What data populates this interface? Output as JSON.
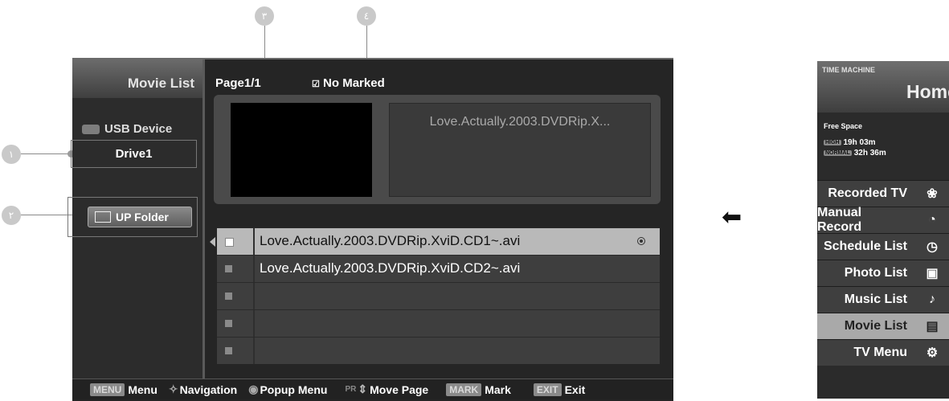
{
  "callouts": [
    "١",
    "٢",
    "٣",
    "٤"
  ],
  "screen": {
    "title": "Movie List",
    "device": "USB Device",
    "drive": "Drive1",
    "up_folder": "UP Folder",
    "page": "Page1/1",
    "marked": "No Marked",
    "preview_title": "Love.Actually.2003.DVDRip.X...",
    "files": [
      {
        "name": "Love.Actually.2003.DVDRip.XviD.CD1~.avi",
        "selected": true
      },
      {
        "name": "Love.Actually.2003.DVDRip.XviD.CD2~.avi",
        "selected": false
      },
      {
        "name": "",
        "selected": false
      },
      {
        "name": "",
        "selected": false
      },
      {
        "name": "",
        "selected": false
      }
    ]
  },
  "bottom_bar": {
    "menu_key": "MENU",
    "menu_label": "Menu",
    "nav_label": "Navigation",
    "popup_label": "Popup Menu",
    "pr_key": "PR",
    "move_label": "Move Page",
    "mark_key": "MARK",
    "mark_label": "Mark",
    "exit_key": "EXIT",
    "exit_label": "Exit"
  },
  "time_machine": {
    "header_small": "TIME MACHINE",
    "header_title": "Home",
    "free_space_label": "Free Space",
    "high_tag": "HIGH",
    "high_value": "19h 03m",
    "normal_tag": "NORMAL",
    "normal_value": "32h 36m",
    "items": [
      {
        "label": "Recorded TV",
        "icon": "film-reel-icon",
        "glyph": "❀",
        "active": false
      },
      {
        "label": "Manual Record",
        "icon": "clock-icon",
        "glyph": "◔",
        "active": false
      },
      {
        "label": "Schedule List",
        "icon": "schedule-icon",
        "glyph": "◷",
        "active": false
      },
      {
        "label": "Photo List",
        "icon": "photo-icon",
        "glyph": "▣",
        "active": false
      },
      {
        "label": "Music List",
        "icon": "music-note-icon",
        "glyph": "♪",
        "active": false
      },
      {
        "label": "Movie List",
        "icon": "movie-icon",
        "glyph": "▤",
        "active": true
      },
      {
        "label": "TV Menu",
        "icon": "gears-icon",
        "glyph": "⚙",
        "active": false
      }
    ]
  }
}
